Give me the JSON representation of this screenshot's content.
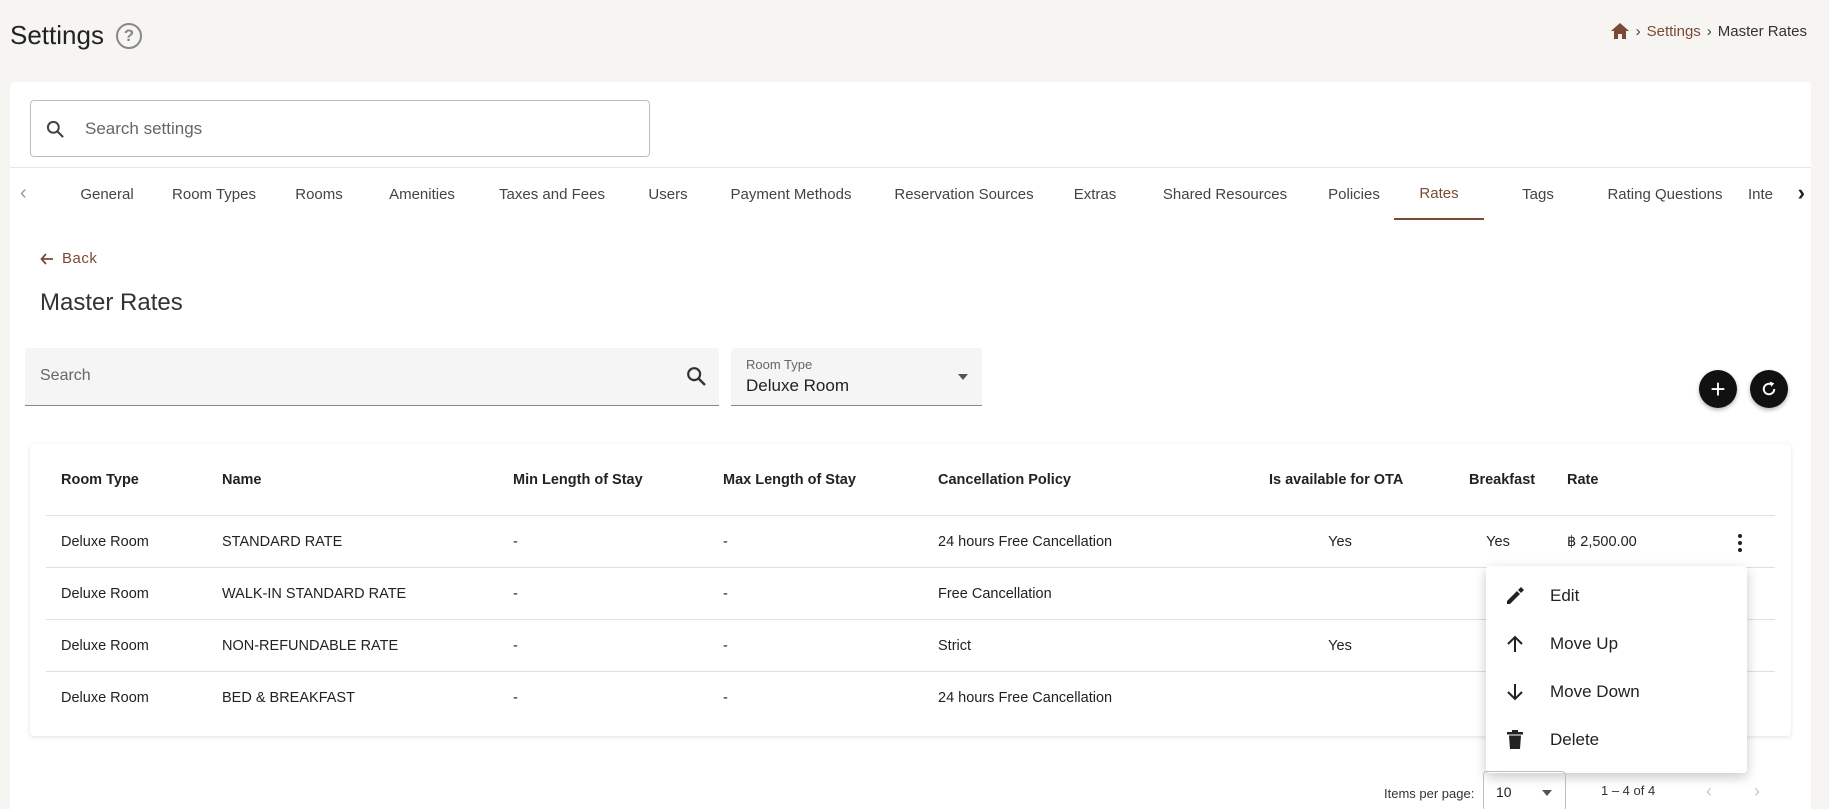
{
  "header": {
    "title": "Settings",
    "help_icon": "help-circle-icon",
    "breadcrumb": {
      "home_icon": "home-icon",
      "items": [
        "Settings",
        "Master Rates"
      ]
    }
  },
  "search": {
    "placeholder": "Search settings",
    "value": ""
  },
  "tabs": [
    {
      "label": "General"
    },
    {
      "label": "Room Types"
    },
    {
      "label": "Rooms"
    },
    {
      "label": "Amenities"
    },
    {
      "label": "Taxes and Fees"
    },
    {
      "label": "Users"
    },
    {
      "label": "Payment Methods"
    },
    {
      "label": "Reservation Sources"
    },
    {
      "label": "Extras"
    },
    {
      "label": "Shared Resources"
    },
    {
      "label": "Policies"
    },
    {
      "label": "Rates",
      "active": true
    },
    {
      "label": "Tags"
    },
    {
      "label": "Rating Questions"
    },
    {
      "label": "Inte"
    }
  ],
  "back_label": "Back",
  "section_title": "Master Rates",
  "filters": {
    "search_placeholder": "Search",
    "room_type_label": "Room Type",
    "room_type_value": "Deluxe Room"
  },
  "table": {
    "headers": [
      "Room Type",
      "Name",
      "Min Length of Stay",
      "Max Length of Stay",
      "Cancellation Policy",
      "Is available for OTA",
      "Breakfast",
      "Rate"
    ],
    "rows": [
      [
        "Deluxe Room",
        "STANDARD RATE",
        "-",
        "-",
        "24 hours Free Cancellation",
        "Yes",
        "Yes",
        "฿ 2,500.00"
      ],
      [
        "Deluxe Room",
        "WALK-IN STANDARD RATE",
        "-",
        "-",
        "Free Cancellation",
        "",
        "",
        ""
      ],
      [
        "Deluxe Room",
        "NON-REFUNDABLE RATE",
        "-",
        "-",
        "Strict",
        "Yes",
        "",
        ""
      ],
      [
        "Deluxe Room",
        "BED & BREAKFAST",
        "-",
        "-",
        "24 hours Free Cancellation",
        "",
        "",
        ""
      ]
    ]
  },
  "context_menu": [
    {
      "label": "Edit",
      "icon": "pencil-icon"
    },
    {
      "label": "Move Up",
      "icon": "arrow-up-icon"
    },
    {
      "label": "Move Down",
      "icon": "arrow-down-icon"
    },
    {
      "label": "Delete",
      "icon": "trash-icon"
    }
  ],
  "pagination": {
    "items_per_page_label": "Items per page:",
    "items_per_page_value": "10",
    "range_label": "1 – 4 of 4"
  },
  "colors": {
    "accent": "#7a4a36",
    "background": "#f6f5f2"
  }
}
